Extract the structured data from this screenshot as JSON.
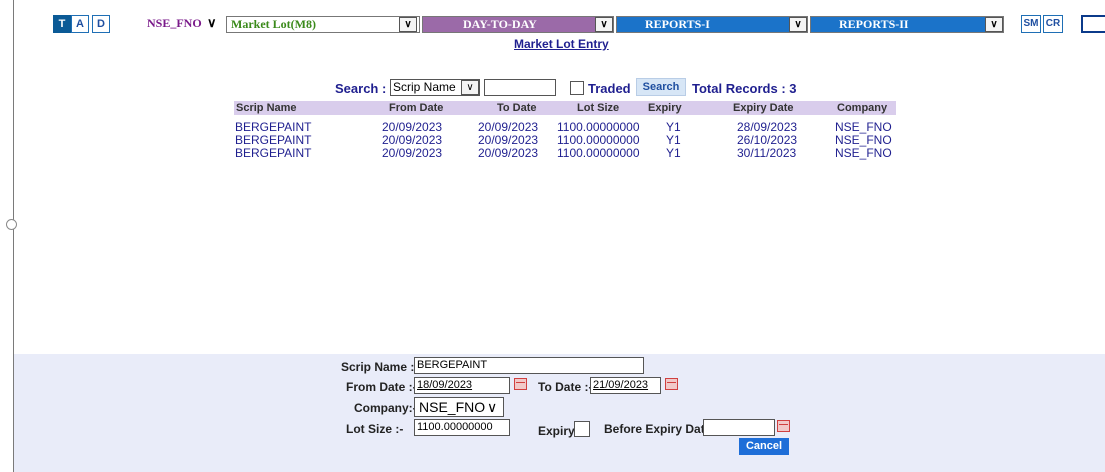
{
  "toolbar": {
    "buttons": [
      "T",
      "A",
      "D"
    ],
    "exchange_select": "NSE_FNO",
    "menu_select": "Market Lot(M8)",
    "day_to_day": "DAY-TO-DAY",
    "reports_1": "REPORTS-I",
    "reports_2": "REPORTS-II",
    "right_buttons": [
      "SM",
      "CR"
    ],
    "colors": {
      "market_lot": "#8ae52a",
      "day_to_day": "#9b6aa8",
      "reports": "#1b73c9"
    }
  },
  "page_title": "Market Lot Entry",
  "search": {
    "label": "Search :",
    "field_select": "Scrip Name",
    "input_value": "",
    "traded_label": "Traded",
    "button": "Search",
    "total_records": "Total Records : 3"
  },
  "table": {
    "columns": [
      "Scrip Name",
      "From Date",
      "To Date",
      "Lot Size",
      "Expiry",
      "Expiry Date",
      "Company"
    ],
    "rows": [
      [
        "BERGEPAINT",
        "20/09/2023",
        "20/09/2023",
        "1100.00000000",
        "Y1",
        "28/09/2023",
        "NSE_FNO"
      ],
      [
        "BERGEPAINT",
        "20/09/2023",
        "20/09/2023",
        "1100.00000000",
        "Y1",
        "26/10/2023",
        "NSE_FNO"
      ],
      [
        "BERGEPAINT",
        "20/09/2023",
        "20/09/2023",
        "1100.00000000",
        "Y1",
        "30/11/2023",
        "NSE_FNO"
      ]
    ]
  },
  "form": {
    "scrip_name_label": "Scrip Name :-",
    "scrip_name_value": "BERGEPAINT",
    "from_date_label": "From Date :-",
    "from_date_value": "18/09/2023",
    "to_date_label": "To Date :-",
    "to_date_value": "21/09/2023",
    "company_label": "Company:-",
    "company_value": "NSE_FNO",
    "lot_size_label": "Lot Size :-",
    "lot_size_value": "1100.00000000",
    "expiry_label": "Expiry",
    "before_expiry_label": "Before Expiry Date",
    "before_expiry_value": "",
    "cancel_button": "Cancel"
  }
}
